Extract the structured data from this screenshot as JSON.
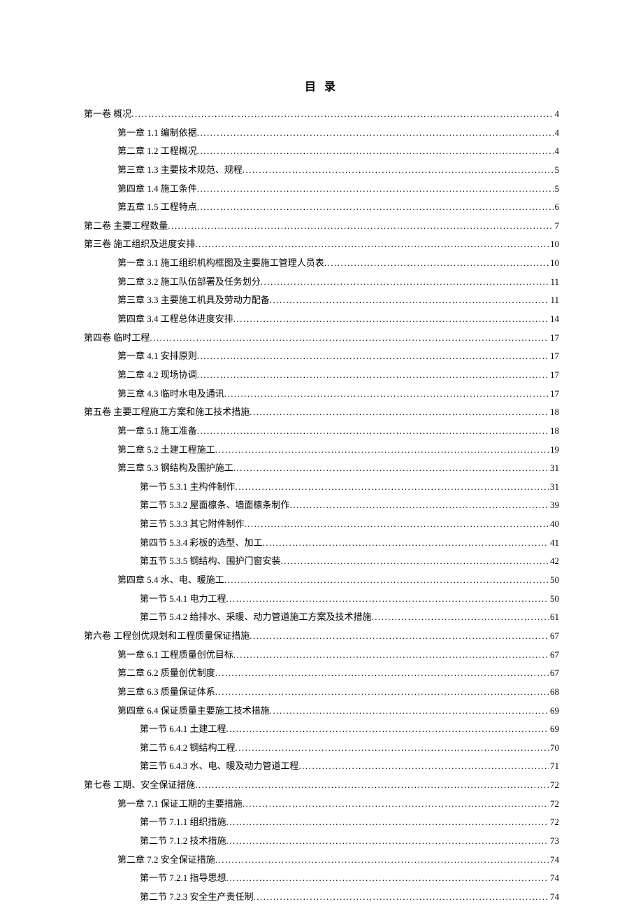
{
  "title": "目 录",
  "entries": [
    {
      "level": 0,
      "label": "第一卷 概况",
      "page": "4"
    },
    {
      "level": 1,
      "label": "第一章 1.1 编制依据",
      "page": "4"
    },
    {
      "level": 1,
      "label": "第二章 1.2 工程概况",
      "page": "4"
    },
    {
      "level": 1,
      "label": "第三章 1.3 主要技术规范、规程",
      "page": "5"
    },
    {
      "level": 1,
      "label": "第四章 1.4 施工条件",
      "page": "5"
    },
    {
      "level": 1,
      "label": "第五章 1.5 工程特点",
      "page": "6"
    },
    {
      "level": 0,
      "label": "第二卷 主要工程数量",
      "page": "7"
    },
    {
      "level": 0,
      "label": "第三卷 施工组织及进度安排",
      "page": "10"
    },
    {
      "level": 1,
      "label": "第一章 3.1 施工组织机构框图及主要施工管理人员表",
      "page": "10"
    },
    {
      "level": 1,
      "label": "第二章 3.2 施工队伍部署及任务划分",
      "page": "11"
    },
    {
      "level": 1,
      "label": "第三章 3.3 主要施工机具及劳动力配备",
      "page": "11"
    },
    {
      "level": 1,
      "label": "第四章 3.4 工程总体进度安排",
      "page": "14"
    },
    {
      "level": 0,
      "label": "第四卷 临时工程",
      "page": "17"
    },
    {
      "level": 1,
      "label": "第一章 4.1 安排原则",
      "page": "17"
    },
    {
      "level": 1,
      "label": "第二章 4.2 现场协调",
      "page": "17"
    },
    {
      "level": 1,
      "label": "第三章 4.3 临时水电及通讯",
      "page": "17"
    },
    {
      "level": 0,
      "label": "第五卷 主要工程施工方案和施工技术措施",
      "page": "18"
    },
    {
      "level": 1,
      "label": "第一章 5.1 施工准备 ",
      "page": "18"
    },
    {
      "level": 1,
      "label": "第二章 5.2 土建工程施工 ",
      "page": "19"
    },
    {
      "level": 1,
      "label": "第三章 5.3 钢结构及围护施工",
      "page": "31"
    },
    {
      "level": 2,
      "label": "第一节 5.3.1 主构件制作 ",
      "page": "31"
    },
    {
      "level": 2,
      "label": "第二节 5.3.2 屋面檩条、墙面檩条制作 ",
      "page": "39"
    },
    {
      "level": 2,
      "label": "第三节 5.3.3 其它附件制作 ",
      "page": "40"
    },
    {
      "level": 2,
      "label": "第四节 5.3.4 彩板的选型、加工 ",
      "page": "41"
    },
    {
      "level": 2,
      "label": "第五节 5.3.5 钢结构、围护门窗安装 ",
      "page": "42"
    },
    {
      "level": 1,
      "label": "第四章 5.4 水、电、暖施工",
      "page": "50"
    },
    {
      "level": 2,
      "label": "第一节 5.4.1 电力工程 ",
      "page": "50"
    },
    {
      "level": 2,
      "label": "第二节 5.4.2 给排水、采暖、动力管道施工方案及技术措施 ",
      "page": "61"
    },
    {
      "level": 0,
      "label": "第六卷 工程创优规划和工程质量保证措施",
      "page": "67"
    },
    {
      "level": 1,
      "label": "第一章 6.1 工程质量创优目标 ",
      "page": "67"
    },
    {
      "level": 1,
      "label": "第二章 6.2 质量创优制度 ",
      "page": "67"
    },
    {
      "level": 1,
      "label": "第三章 6.3 质量保证体系 ",
      "page": "68"
    },
    {
      "level": 1,
      "label": "第四章 6.4 保证质量主要施工技术措施 ",
      "page": "69"
    },
    {
      "level": 2,
      "label": "第一节 6.4.1 土建工程",
      "page": "69"
    },
    {
      "level": 2,
      "label": "第二节 6.4.2 钢结构工程 ",
      "page": "70"
    },
    {
      "level": 2,
      "label": "第三节 6.4.3 水、电、暖及动力管道工程 ",
      "page": "71"
    },
    {
      "level": 0,
      "label": "第七卷 工期、安全保证措施",
      "page": "72"
    },
    {
      "level": 1,
      "label": "第一章 7.1 保证工期的主要措施 ",
      "page": "72"
    },
    {
      "level": 2,
      "label": "第一节 7.1.1 组织措施",
      "page": "72"
    },
    {
      "level": 2,
      "label": "第二节 7.1.2 技术措施",
      "page": "73"
    },
    {
      "level": 1,
      "label": "第二章 7.2 安全保证措施 ",
      "page": "74"
    },
    {
      "level": 2,
      "label": "第一节 7.2.1 指导思想",
      "page": "74"
    },
    {
      "level": 2,
      "label": "第二节 7.2.3 安全生产责任制",
      "page": "74"
    }
  ]
}
